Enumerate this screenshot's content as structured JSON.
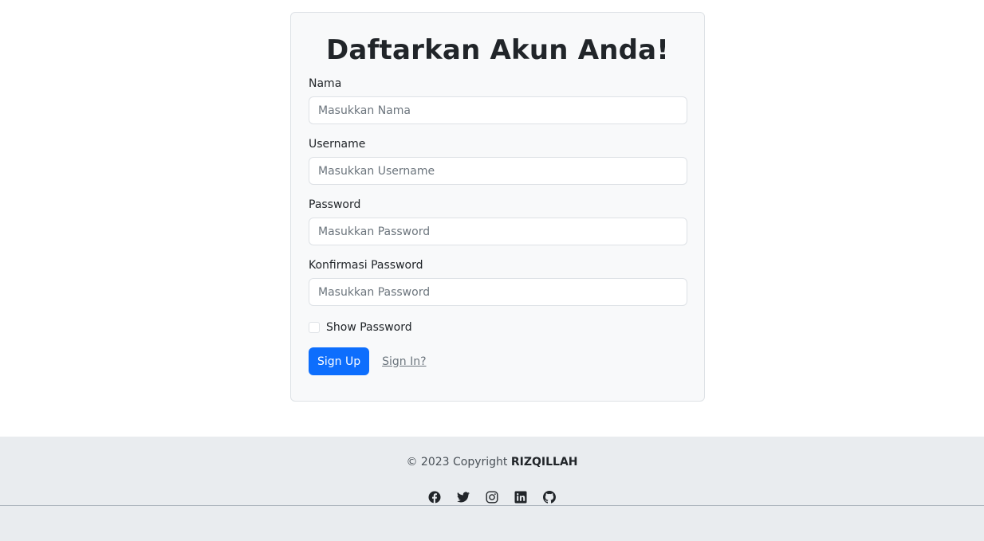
{
  "form": {
    "title": "Daftarkan Akun Anda!",
    "fields": [
      {
        "label": "Nama",
        "placeholder": "Masukkan Nama",
        "value": ""
      },
      {
        "label": "Username",
        "placeholder": "Masukkan Username",
        "value": ""
      },
      {
        "label": "Password",
        "placeholder": "Masukkan Password",
        "value": ""
      },
      {
        "label": "Konfirmasi Password",
        "placeholder": "Masukkan Password",
        "value": ""
      }
    ],
    "show_password_label": "Show Password",
    "show_password_checked": false,
    "signup_label": "Sign Up",
    "signin_link": "Sign In?"
  },
  "footer": {
    "copyright_prefix": "© 2023 Copyright ",
    "copyright_name": "RIZQILLAH",
    "socials": [
      "facebook-icon",
      "twitter-icon",
      "instagram-icon",
      "linkedin-icon",
      "github-icon"
    ]
  },
  "colors": {
    "primary": "#0d6efd",
    "card_bg": "#f8f9fa",
    "footer_bg": "#e9ecef"
  }
}
